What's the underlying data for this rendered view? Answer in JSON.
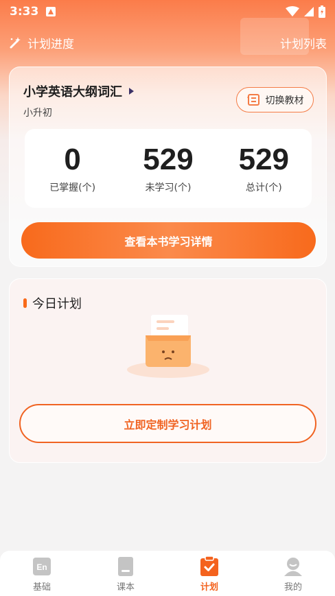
{
  "status_bar": {
    "time": "3:33"
  },
  "header": {
    "title": "计划进度",
    "right_link": "计划列表"
  },
  "book": {
    "title": "小学英语大纲词汇",
    "subtitle": "小升初",
    "switch_label": "切换教材",
    "stats": [
      {
        "value": "0",
        "label": "已掌握(个)"
      },
      {
        "value": "529",
        "label": "未学习(个)"
      },
      {
        "value": "529",
        "label": "总计(个)"
      }
    ],
    "detail_button": "查看本书学习详情"
  },
  "plan": {
    "title": "今日计划",
    "create_button": "立即定制学习计划"
  },
  "nav": {
    "items": [
      {
        "label": "基础",
        "icon": "en-book-icon"
      },
      {
        "label": "课本",
        "icon": "textbook-icon"
      },
      {
        "label": "计划",
        "icon": "plan-clipboard-icon"
      },
      {
        "label": "我的",
        "icon": "profile-icon"
      }
    ],
    "active_index": 2
  },
  "colors": {
    "accent": "#f4621d",
    "nav_inactive": "#b9b9b9"
  }
}
